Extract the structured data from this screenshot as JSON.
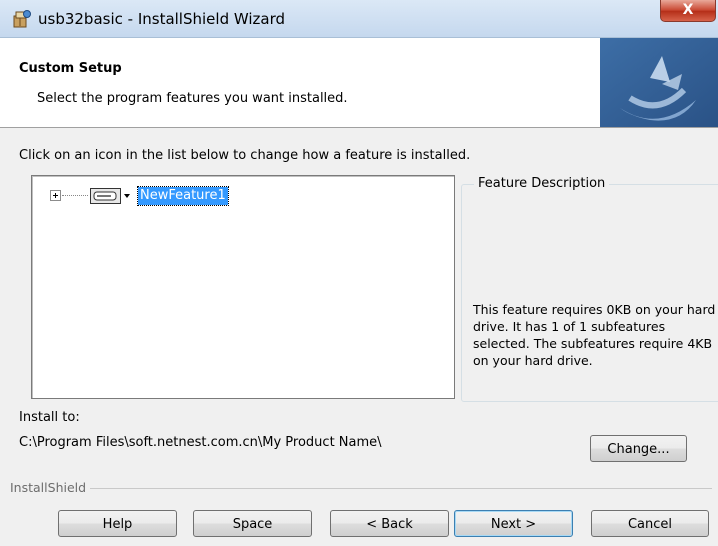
{
  "window": {
    "title": "usb32basic - InstallShield Wizard",
    "close_glyph": "X"
  },
  "banner": {
    "title": "Custom Setup",
    "subtitle": "Select the program features you want installed."
  },
  "instruction": "Click on an icon in the list below to change how a feature is installed.",
  "tree": {
    "items": [
      {
        "label": "NewFeature1",
        "icon": "hard-drive-icon",
        "expander": "plus",
        "selected": true
      }
    ]
  },
  "description": {
    "legend": "Feature Description",
    "text": "This feature requires 0KB on your hard drive. It has 1 of 1 subfeatures selected. The subfeatures require 4KB on your hard drive."
  },
  "install": {
    "label": "Install to:",
    "path": "C:\\Program Files\\soft.netnest.com.cn\\My Product Name\\"
  },
  "buttons": {
    "change": "Change...",
    "help": "Help",
    "space": "Space",
    "back": "< Back",
    "next": "Next >",
    "cancel": "Cancel"
  },
  "brand": "InstallShield",
  "colors": {
    "selection": "#3399ff",
    "close_red": "#c8452f",
    "banner_accent": "#2f5f97"
  }
}
